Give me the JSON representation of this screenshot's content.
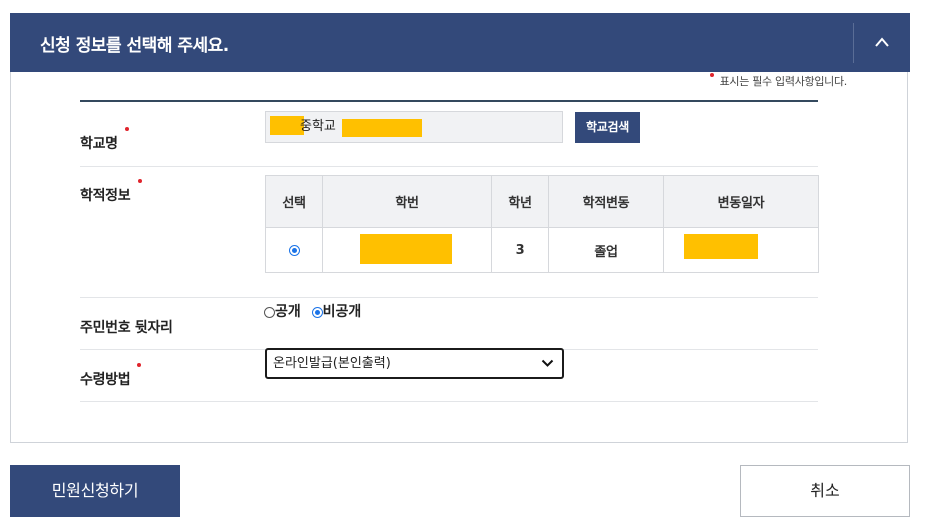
{
  "header": {
    "title": "신청 정보를 선택해 주세요.",
    "collapse_icon": "chevron-up-icon"
  },
  "required_note": "표시는 필수 입력사항입니다.",
  "colors": {
    "primary": "#33497a",
    "required": "#e0242c",
    "mask": "#ffc000",
    "radio": "#1a73e8"
  },
  "school": {
    "label": "학교명",
    "value_visible_suffix": "중학교",
    "search_button": "학교검색"
  },
  "records": {
    "label": "학적정보",
    "columns": [
      "선택",
      "학번",
      "학년",
      "학적변동",
      "변동일자"
    ],
    "rows": [
      {
        "grade": "3",
        "status": "졸업",
        "selected": true
      }
    ]
  },
  "rrn": {
    "label": "주민번호 뒷자리",
    "options": [
      "공개",
      "비공개"
    ],
    "selected": "비공개"
  },
  "receive": {
    "label": "수령방법",
    "selected": "온라인발급(본인출력)"
  },
  "actions": {
    "submit": "민원신청하기",
    "cancel": "취소"
  }
}
